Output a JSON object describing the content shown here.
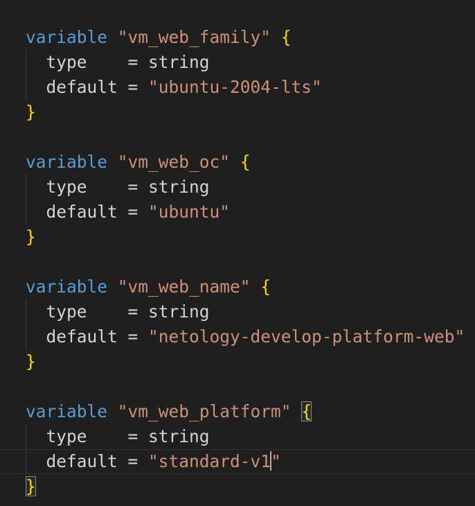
{
  "editor": {
    "blocks": [
      {
        "keyword": "variable",
        "name": "\"vm_web_family\"",
        "open_brace": "{",
        "type_key": "type",
        "type_eq": "    = ",
        "type_val": "string",
        "default_key": "default",
        "default_eq": " = ",
        "default_val": "\"ubuntu-2004-lts\"",
        "close_brace": "}"
      },
      {
        "keyword": "variable",
        "name": "\"vm_web_oc\"",
        "open_brace": "{",
        "type_key": "type",
        "type_eq": "    = ",
        "type_val": "string",
        "default_key": "default",
        "default_eq": " = ",
        "default_val": "\"ubuntu\"",
        "close_brace": "}"
      },
      {
        "keyword": "variable",
        "name": "\"vm_web_name\"",
        "open_brace": "{",
        "type_key": "type",
        "type_eq": "    = ",
        "type_val": "string",
        "default_key": "default",
        "default_eq": " = ",
        "default_val": "\"netology-develop-platform-web\"",
        "close_brace": "}"
      },
      {
        "keyword": "variable",
        "name": "\"vm_web_platform\"",
        "open_brace": "{",
        "type_key": "type",
        "type_eq": "    = ",
        "type_val": "string",
        "default_key": "default",
        "default_eq": " = ",
        "default_val_before_cursor": "\"standard-v1",
        "default_val_after_cursor": "\"",
        "close_brace": "}"
      }
    ],
    "colors": {
      "background": "#1f1f1f",
      "keyword": "#569cd6",
      "string": "#ce9178",
      "bracket": "#ffd700",
      "text": "#d4d4d4"
    }
  }
}
